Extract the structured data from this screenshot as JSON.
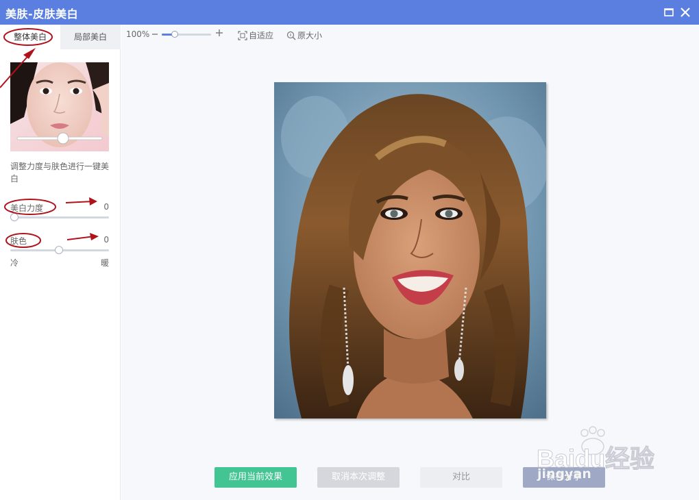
{
  "window": {
    "title": "美肤-皮肤美白",
    "maximize_icon": "maximize-icon",
    "close_icon": "close-icon"
  },
  "left_panel": {
    "tabs": [
      {
        "label": "整体美白",
        "active": true
      },
      {
        "label": "局部美白",
        "active": false
      }
    ],
    "description": "调整力度与肤色进行一键美白",
    "sliders": [
      {
        "label": "美白力度",
        "value": "0"
      },
      {
        "label": "肤色",
        "value": "0",
        "min_label": "冷",
        "max_label": "暖"
      }
    ]
  },
  "toolbar": {
    "zoom_level": "100%",
    "zoom_out_icon": "minus-icon",
    "zoom_in_icon": "plus-icon",
    "fit_label": "自适应",
    "original_size_label": "原大小"
  },
  "actions": {
    "apply": "应用当前效果",
    "cancel": "取消本次调整",
    "compare": "对比",
    "share": "保存分享"
  },
  "watermark": {
    "brand": "Baidu经验",
    "site": "jingyan"
  },
  "colors": {
    "titlebar": "#5b7fe0",
    "apply_button": "#43c593",
    "annotation": "#b0121b"
  }
}
